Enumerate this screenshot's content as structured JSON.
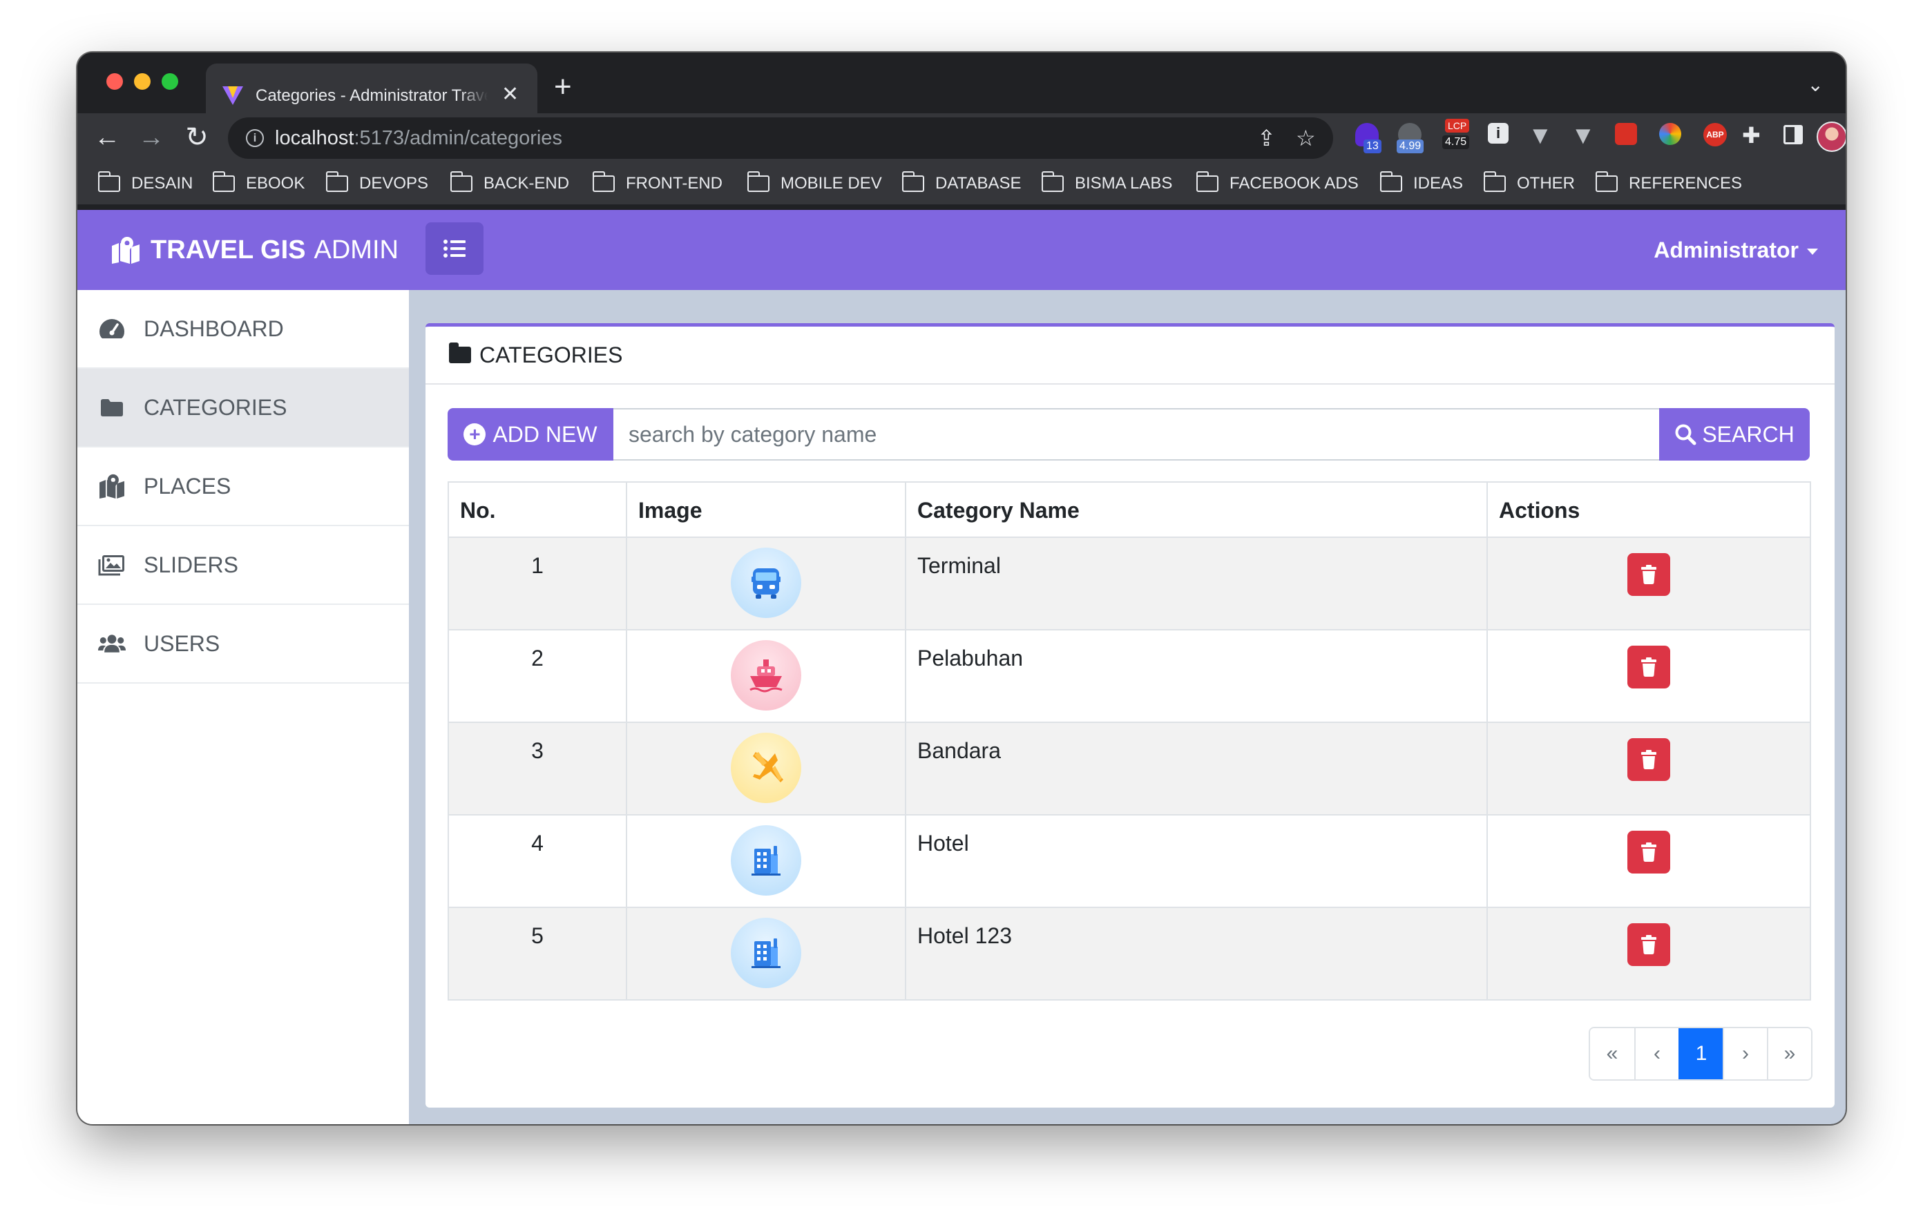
{
  "browser": {
    "tab_title": "Categories - Administrator Travel GIS",
    "url_host": "localhost",
    "url_rest": ":5173/admin/categories",
    "extension_badges": {
      "ext1": "13",
      "ext2": "4.99",
      "ext3_top": "LCP",
      "ext3_bottom": "4.75",
      "abp": "ABP"
    }
  },
  "bookmarks": [
    "DESAIN",
    "EBOOK",
    "DEVOPS",
    "BACK-END",
    "FRONT-END",
    "MOBILE DEV",
    "DATABASE",
    "BISMA LABS",
    "FACEBOOK ADS",
    "IDEAS",
    "OTHER",
    "REFERENCES"
  ],
  "navbar": {
    "brand_strong": "TRAVEL GIS",
    "brand_light": "ADMIN",
    "user": "Administrator"
  },
  "sidebar": {
    "items": [
      {
        "label": "DASHBOARD",
        "icon": "tachometer-icon"
      },
      {
        "label": "CATEGORIES",
        "icon": "folder-icon"
      },
      {
        "label": "PLACES",
        "icon": "map-marked-icon"
      },
      {
        "label": "SLIDERS",
        "icon": "images-icon"
      },
      {
        "label": "USERS",
        "icon": "users-icon"
      }
    ],
    "active": "CATEGORIES"
  },
  "card": {
    "title": "CATEGORIES",
    "add_label": "ADD NEW",
    "search_placeholder": "search by category name",
    "search_label": "SEARCH"
  },
  "table": {
    "headers": [
      "No.",
      "Image",
      "Category Name",
      "Actions"
    ],
    "rows": [
      {
        "no": "1",
        "name": "Terminal",
        "icon": "bus-icon"
      },
      {
        "no": "2",
        "name": "Pelabuhan",
        "icon": "ship-icon"
      },
      {
        "no": "3",
        "name": "Bandara",
        "icon": "airplane-icon"
      },
      {
        "no": "4",
        "name": "Hotel",
        "icon": "hotel-icon"
      },
      {
        "no": "5",
        "name": "Hotel 123",
        "icon": "hotel-icon"
      }
    ]
  },
  "pagination": {
    "first": "«",
    "prev": "‹",
    "current": "1",
    "next": "›",
    "last": "»"
  },
  "colors": {
    "accent": "#8066e0",
    "danger": "#dc3545",
    "page_active": "#0d6efd"
  }
}
